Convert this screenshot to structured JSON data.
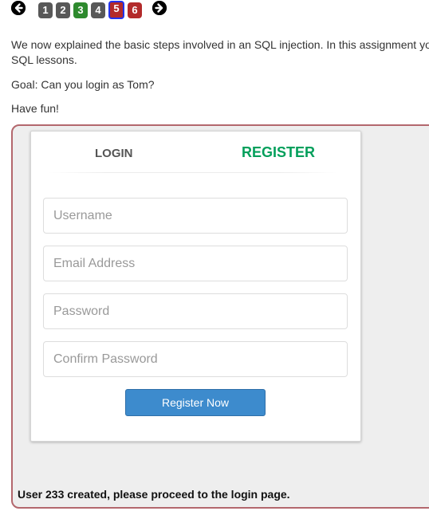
{
  "navigation": {
    "prev_icon": "arrow-left-circle",
    "next_icon": "arrow-right-circle",
    "pages": [
      {
        "label": "1",
        "status": "gray"
      },
      {
        "label": "2",
        "status": "gray"
      },
      {
        "label": "3",
        "status": "green"
      },
      {
        "label": "4",
        "status": "gray"
      },
      {
        "label": "5",
        "status": "current"
      },
      {
        "label": "6",
        "status": "red"
      }
    ]
  },
  "lesson": {
    "intro_line1": "We now explained the basic steps involved in an SQL injection. In this assignment yo",
    "intro_line2": "SQL lessons.",
    "goal": "Goal: Can you login as Tom?",
    "have_fun": "Have fun!"
  },
  "form": {
    "tab_login": "LOGIN",
    "tab_register": "REGISTER",
    "active_tab": "REGISTER",
    "username_placeholder": "Username",
    "email_placeholder": "Email Address",
    "password_placeholder": "Password",
    "confirm_password_placeholder": "Confirm Password",
    "register_button": "Register Now"
  },
  "feedback": {
    "message": "User 233 created, please proceed to the login page."
  },
  "colors": {
    "register_tab": "#029f5b",
    "register_button": "#3d8bcd",
    "container_border": "#b3676d",
    "page_current_border": "#2233ee",
    "page_complete": "#2e8a2e",
    "page_incomplete": "#585858",
    "page_red": "#b32a2a"
  }
}
